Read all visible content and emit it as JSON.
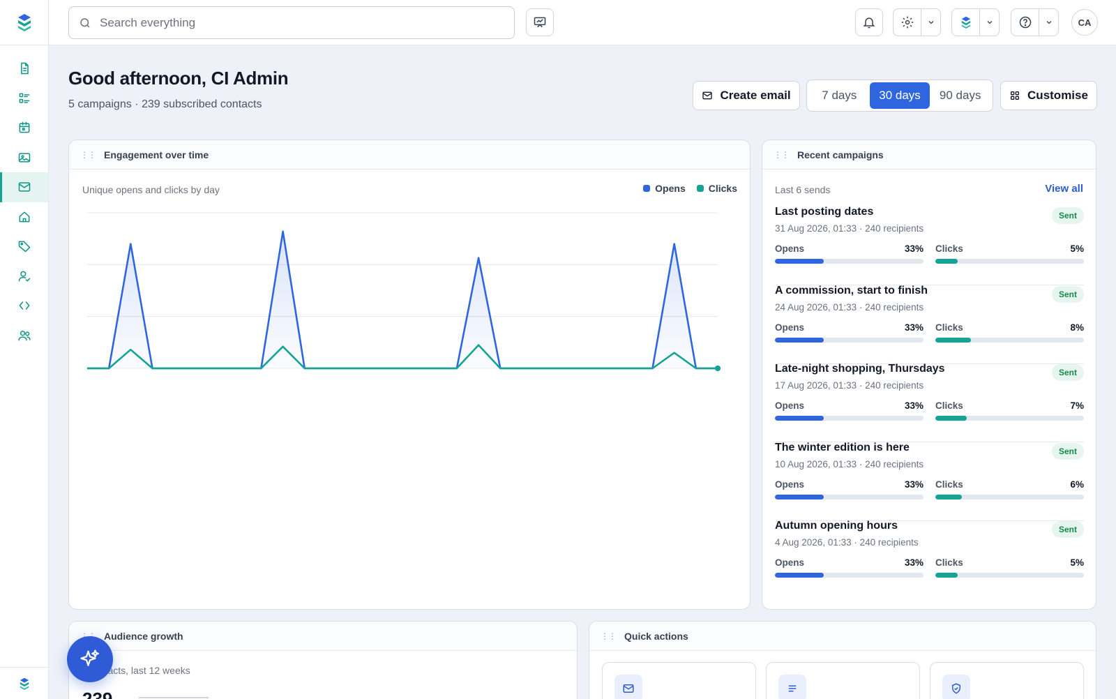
{
  "topbar": {
    "search_placeholder": "Search everything",
    "avatar_initials": "CA"
  },
  "header": {
    "greeting": "Good afternoon, CI Admin",
    "subtitle": "5 campaigns · 239 subscribed contacts",
    "create_email_label": "Create email",
    "range_options": [
      "7 days",
      "30 days",
      "90 days"
    ],
    "range_selected": "30 days",
    "customise_label": "Customise"
  },
  "sidebar": {
    "items": [
      {
        "icon": "document-icon",
        "active": false
      },
      {
        "icon": "list-icon",
        "active": false
      },
      {
        "icon": "calendar-icon",
        "active": false
      },
      {
        "icon": "image-icon",
        "active": false
      },
      {
        "icon": "mail-icon",
        "active": true
      },
      {
        "icon": "home-icon",
        "active": false
      },
      {
        "icon": "tag-icon",
        "active": false
      },
      {
        "icon": "user-check-icon",
        "active": false
      },
      {
        "icon": "code-icon",
        "active": false
      },
      {
        "icon": "users-icon",
        "active": false
      }
    ]
  },
  "engagement": {
    "title": "Engagement over time",
    "subtitle": "Unique opens and clicks by day",
    "legend_opens": "Opens",
    "legend_clicks": "Clicks"
  },
  "chart_data": {
    "type": "area",
    "title": "Engagement over time",
    "subtitle": "Unique opens and clicks by day",
    "x": [
      1,
      2,
      3,
      4,
      5,
      6,
      7,
      8,
      9,
      10,
      11,
      12,
      13,
      14,
      15,
      16,
      17,
      18,
      19,
      20,
      21,
      22,
      23,
      24,
      25,
      26,
      27,
      28,
      29,
      30
    ],
    "ylim": [
      0,
      100
    ],
    "grid": true,
    "legend": "top-right",
    "series": [
      {
        "name": "Opens",
        "color": "#2f66e0",
        "values": [
          0,
          0,
          80,
          0,
          0,
          0,
          0,
          0,
          0,
          88,
          0,
          0,
          0,
          0,
          0,
          0,
          0,
          0,
          71,
          0,
          0,
          0,
          0,
          0,
          0,
          0,
          0,
          80,
          0,
          0
        ]
      },
      {
        "name": "Clicks",
        "color": "#14a394",
        "values": [
          0,
          0,
          12,
          0,
          0,
          0,
          0,
          0,
          0,
          14,
          0,
          0,
          0,
          0,
          0,
          0,
          0,
          0,
          15,
          0,
          0,
          0,
          0,
          0,
          0,
          0,
          0,
          10,
          0,
          0
        ]
      }
    ]
  },
  "recent": {
    "title": "Recent campaigns",
    "subtitle": "Last 6 sends",
    "view_all": "View all",
    "opens_label": "Opens",
    "clicks_label": "Clicks",
    "campaigns": [
      {
        "title": "Last posting dates",
        "meta": "31 Aug 2026, 01:33 · 240 recipients",
        "status": "Sent",
        "opens": "33%",
        "opens_pct": 33,
        "clicks": "5%",
        "clicks_pct": 15
      },
      {
        "title": "A commission, start to finish",
        "meta": "24 Aug 2026, 01:33 · 240 recipients",
        "status": "Sent",
        "opens": "33%",
        "opens_pct": 33,
        "clicks": "8%",
        "clicks_pct": 24
      },
      {
        "title": "Late-night shopping, Thursdays",
        "meta": "17 Aug 2026, 01:33 · 240 recipients",
        "status": "Sent",
        "opens": "33%",
        "opens_pct": 33,
        "clicks": "7%",
        "clicks_pct": 21
      },
      {
        "title": "The winter edition is here",
        "meta": "10 Aug 2026, 01:33 · 240 recipients",
        "status": "Sent",
        "opens": "33%",
        "opens_pct": 33,
        "clicks": "6%",
        "clicks_pct": 18
      },
      {
        "title": "Autumn opening hours",
        "meta": "4 Aug 2026, 01:33 · 240 recipients",
        "status": "Sent",
        "opens": "33%",
        "opens_pct": 33,
        "clicks": "5%",
        "clicks_pct": 15
      }
    ]
  },
  "audience": {
    "title": "Audience growth",
    "subtitle": "ontacts, last 12 weeks",
    "value": "239"
  },
  "quick_actions": {
    "title": "Quick actions",
    "tiles": [
      {
        "icon": "mail-icon"
      },
      {
        "icon": "list-lines-icon"
      },
      {
        "icon": "shield-check-icon"
      }
    ]
  },
  "colors": {
    "accent": "#2f66e0",
    "teal": "#14a394",
    "sent_badge_bg": "#e6f6ee",
    "sent_badge_text": "#168a4a"
  }
}
